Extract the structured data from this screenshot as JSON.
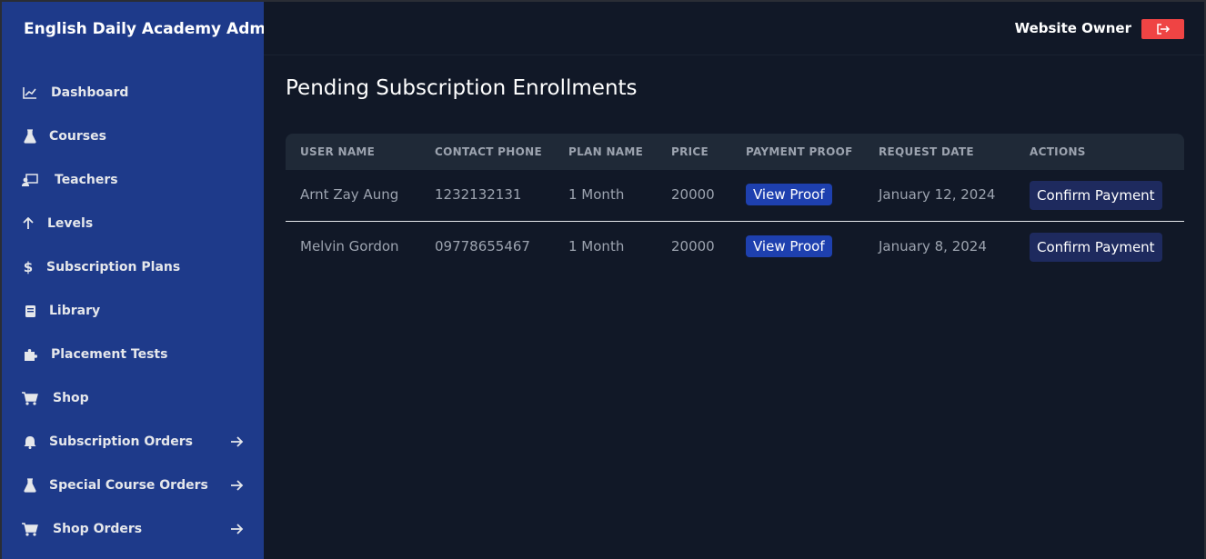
{
  "sidebar": {
    "brand": "English Daily Academy Admin",
    "items": [
      {
        "label": "Dashboard",
        "icon": "chart-line-icon"
      },
      {
        "label": "Courses",
        "icon": "flask-icon"
      },
      {
        "label": "Teachers",
        "icon": "chalkboard-teacher-icon"
      },
      {
        "label": "Levels",
        "icon": "arrow-up-icon"
      },
      {
        "label": "Subscription Plans",
        "icon": "dollar-icon"
      },
      {
        "label": "Library",
        "icon": "book-icon"
      },
      {
        "label": "Placement Tests",
        "icon": "puzzle-icon"
      },
      {
        "label": "Shop",
        "icon": "cart-icon"
      },
      {
        "label": "Subscription Orders",
        "icon": "bell-icon"
      },
      {
        "label": "Special Course Orders",
        "icon": "flask-icon"
      },
      {
        "label": "Shop Orders",
        "icon": "cart-icon"
      }
    ]
  },
  "header": {
    "owner": "Website Owner",
    "logout_icon": "logout-icon"
  },
  "main": {
    "title": "Pending Subscription Enrollments",
    "columns": [
      "USER NAME",
      "CONTACT PHONE",
      "PLAN NAME",
      "PRICE",
      "PAYMENT PROOF",
      "REQUEST DATE",
      "ACTIONS"
    ],
    "rows": [
      {
        "user": "Arnt Zay Aung",
        "phone": "1232132131",
        "plan": "1 Month",
        "price": "20000",
        "proof": "View Proof",
        "date": "January 12, 2024",
        "action": "Confirm Payment"
      },
      {
        "user": "Melvin Gordon",
        "phone": "09778655467",
        "plan": "1 Month",
        "price": "20000",
        "proof": "View Proof",
        "date": "January 8, 2024",
        "action": "Confirm Payment"
      }
    ]
  },
  "colors": {
    "sidebar_bg": "#1e3a8a",
    "page_bg": "#111827",
    "logout_bg": "#ef4444",
    "proof_button": "#1e40af",
    "confirm_button": "#1e2a5e"
  }
}
